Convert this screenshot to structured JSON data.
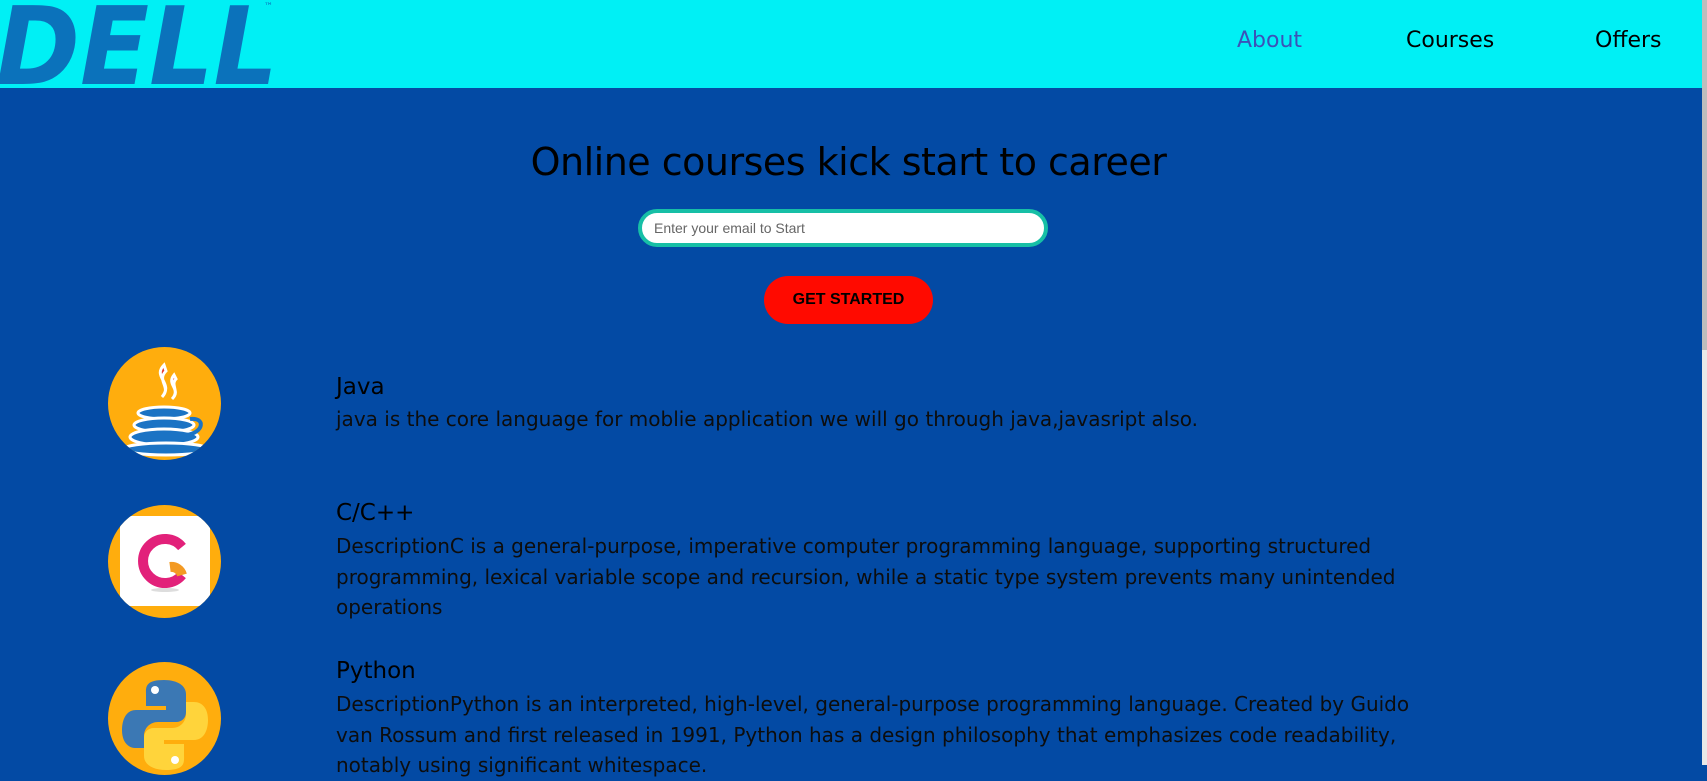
{
  "header": {
    "logo_text": "DELL",
    "logo_mark": "™",
    "nav": [
      {
        "label": "About",
        "active": true
      },
      {
        "label": "Courses",
        "active": false
      },
      {
        "label": "Offers",
        "active": false
      }
    ]
  },
  "hero": {
    "title": "Online courses kick start to career",
    "email_placeholder": "Enter your email to Start",
    "cta_label": "GET STARTED"
  },
  "courses": [
    {
      "title": "Java",
      "description": "java is the core language for moblie application we will go through java,javasript also.",
      "icon": "java-coffee-icon"
    },
    {
      "title": "C/C++",
      "description": "DescriptionC is a general-purpose, imperative computer programming language, supporting structured programming, lexical variable scope and recursion, while a static type system prevents many unintended operations",
      "icon": "c-language-icon"
    },
    {
      "title": "Python",
      "description": "DescriptionPython is an interpreted, high-level, general-purpose programming language. Created by Guido van Rossum and first released in 1991, Python has a design philosophy that emphasizes code readability, notably using significant whitespace.",
      "icon": "python-icon"
    }
  ],
  "colors": {
    "header_bg": "#00f0f5",
    "page_bg": "#034aa4",
    "icon_bg": "#ffad0d",
    "cta_bg": "#ff0a00",
    "input_border": "#17bfa6",
    "logo": "#0b72bb"
  }
}
